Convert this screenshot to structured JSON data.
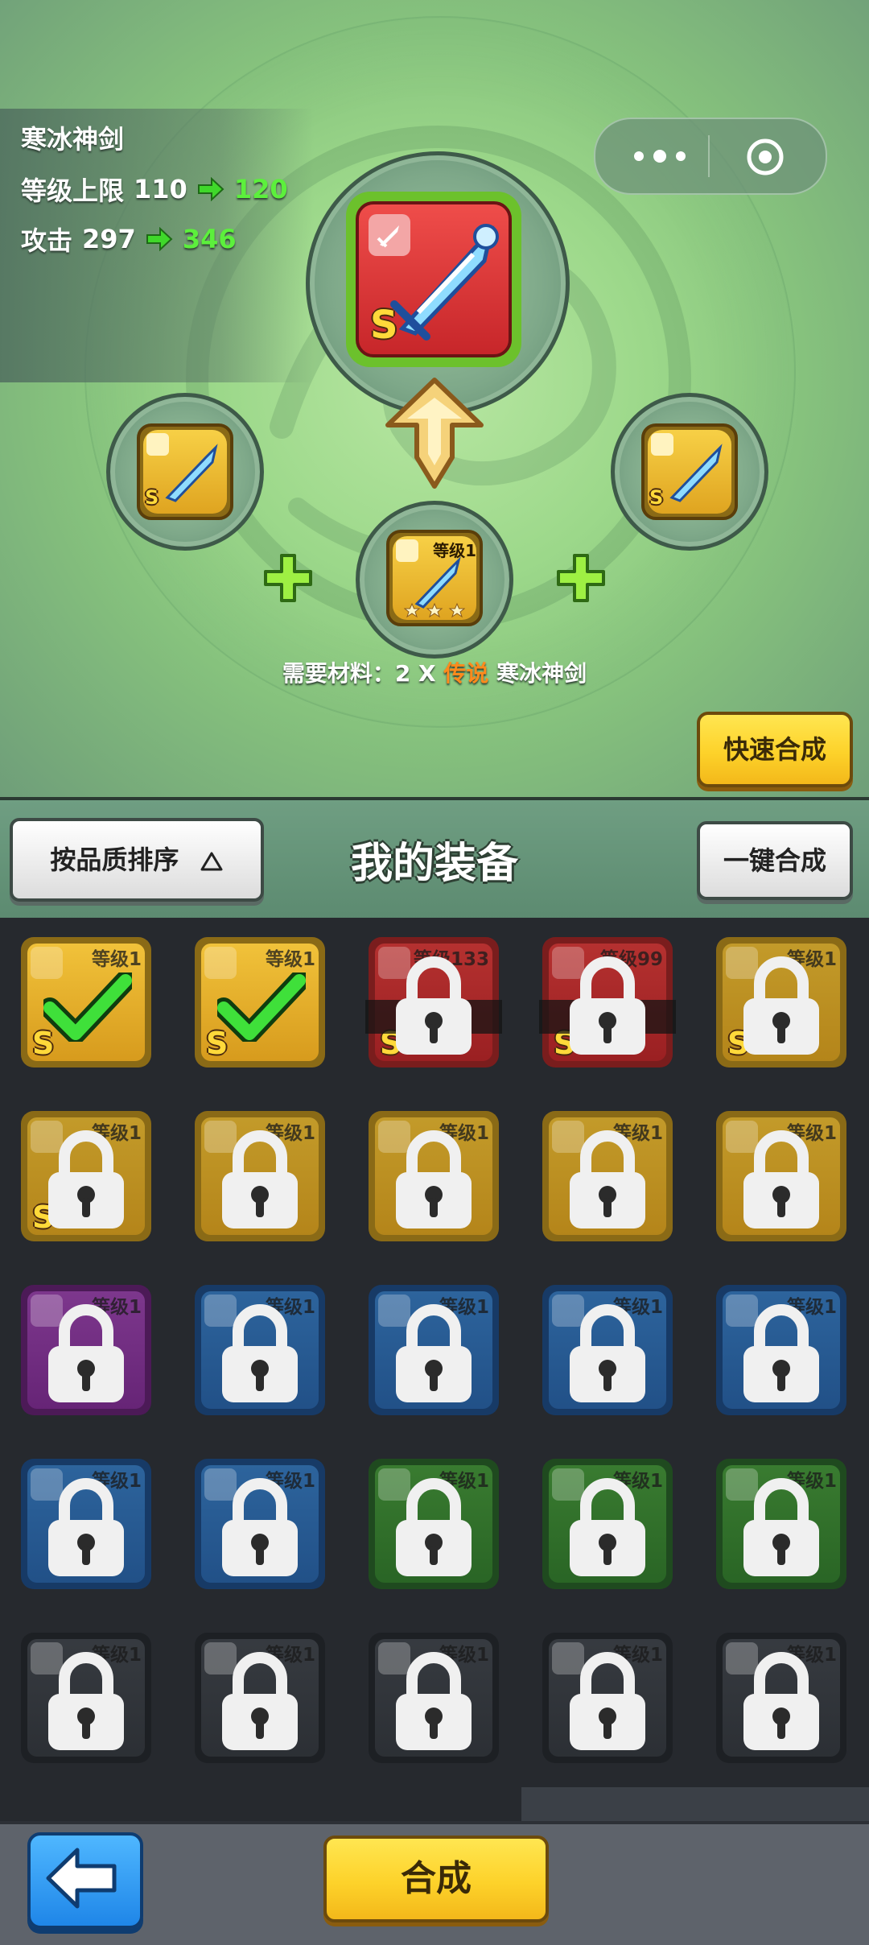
{
  "item": {
    "name": "寒冰神剑",
    "level_cap_label": "等级上限",
    "level_cap_current": "110",
    "level_cap_new": "120",
    "attack_label": "攻击",
    "attack_current": "297",
    "attack_new": "346",
    "grade": "S"
  },
  "material_slot": {
    "level_text": "等级1"
  },
  "requirement": {
    "prefix": "需要材料：2 X",
    "rarity": "传说",
    "item_name": "寒冰神剑"
  },
  "buttons": {
    "quick_merge": "快速合成",
    "sort": "按品质排序",
    "merge_all": "一键合成",
    "merge": "合成"
  },
  "section_title": "我的装备",
  "inventory": [
    {
      "level": "等级1",
      "quality": "legend",
      "state": "selected",
      "grade": "S"
    },
    {
      "level": "等级1",
      "quality": "legend",
      "state": "selected",
      "grade": "S"
    },
    {
      "level": "等级133",
      "quality": "red",
      "state": "locked",
      "grade": "S"
    },
    {
      "level": "等级99",
      "quality": "red",
      "state": "locked",
      "grade": "S"
    },
    {
      "level": "等级1",
      "quality": "legend",
      "state": "locked",
      "grade": "S"
    },
    {
      "level": "等级1",
      "quality": "legend",
      "state": "locked",
      "grade": "S"
    },
    {
      "level": "等级1",
      "quality": "legend",
      "state": "locked",
      "grade": ""
    },
    {
      "level": "等级1",
      "quality": "legend",
      "state": "locked",
      "grade": ""
    },
    {
      "level": "等级1",
      "quality": "legend",
      "state": "locked",
      "grade": ""
    },
    {
      "level": "等级1",
      "quality": "legend",
      "state": "locked",
      "grade": ""
    },
    {
      "level": "等级1",
      "quality": "purple",
      "state": "locked",
      "grade": ""
    },
    {
      "level": "等级1",
      "quality": "blue",
      "state": "locked",
      "grade": ""
    },
    {
      "level": "等级1",
      "quality": "blue",
      "state": "locked",
      "grade": ""
    },
    {
      "level": "等级1",
      "quality": "blue",
      "state": "locked",
      "grade": ""
    },
    {
      "level": "等级1",
      "quality": "blue",
      "state": "locked",
      "grade": ""
    },
    {
      "level": "等级1",
      "quality": "blue",
      "state": "locked",
      "grade": ""
    },
    {
      "level": "等级1",
      "quality": "blue",
      "state": "locked",
      "grade": ""
    },
    {
      "level": "等级1",
      "quality": "green",
      "state": "locked",
      "grade": ""
    },
    {
      "level": "等级1",
      "quality": "green",
      "state": "locked",
      "grade": ""
    },
    {
      "level": "等级1",
      "quality": "green",
      "state": "locked",
      "grade": ""
    },
    {
      "level": "等级1",
      "quality": "gray",
      "state": "locked",
      "grade": ""
    },
    {
      "level": "等级1",
      "quality": "gray",
      "state": "locked",
      "grade": ""
    },
    {
      "level": "等级1",
      "quality": "gray",
      "state": "locked",
      "grade": ""
    },
    {
      "level": "等级1",
      "quality": "gray",
      "state": "locked",
      "grade": ""
    },
    {
      "level": "等级1",
      "quality": "gray",
      "state": "locked",
      "grade": ""
    }
  ],
  "icons": {
    "capsule_menu": "more-dots-icon",
    "capsule_close": "target-icon",
    "back": "back-arrow-icon"
  },
  "colors": {
    "stat_increase": "#5cf03c",
    "legend_highlight": "#ff8a1c",
    "primary_button": "#fdd22a",
    "back_button": "#1f86e8"
  }
}
